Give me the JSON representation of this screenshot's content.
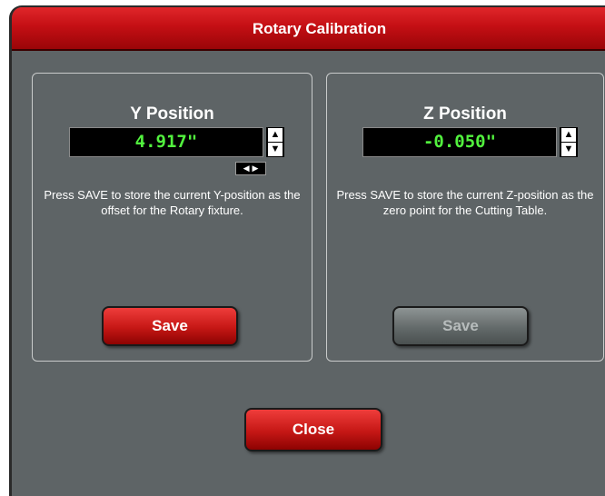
{
  "window": {
    "title": "Rotary Calibration"
  },
  "y_panel": {
    "title": "Y Position",
    "value": "4.917\"",
    "description": "Press SAVE to store the current Y-position as the offset for the Rotary fixture.",
    "save_label": "Save",
    "save_enabled": true
  },
  "z_panel": {
    "title": "Z Position",
    "value": "-0.050\"",
    "description": "Press SAVE to store the current Z-position as the zero point for the Cutting Table.",
    "save_label": "Save",
    "save_enabled": false
  },
  "close_label": "Close",
  "colors": {
    "accent_red": "#c40f14",
    "panel_bg": "#5e6466",
    "readout_green": "#52f23e"
  }
}
